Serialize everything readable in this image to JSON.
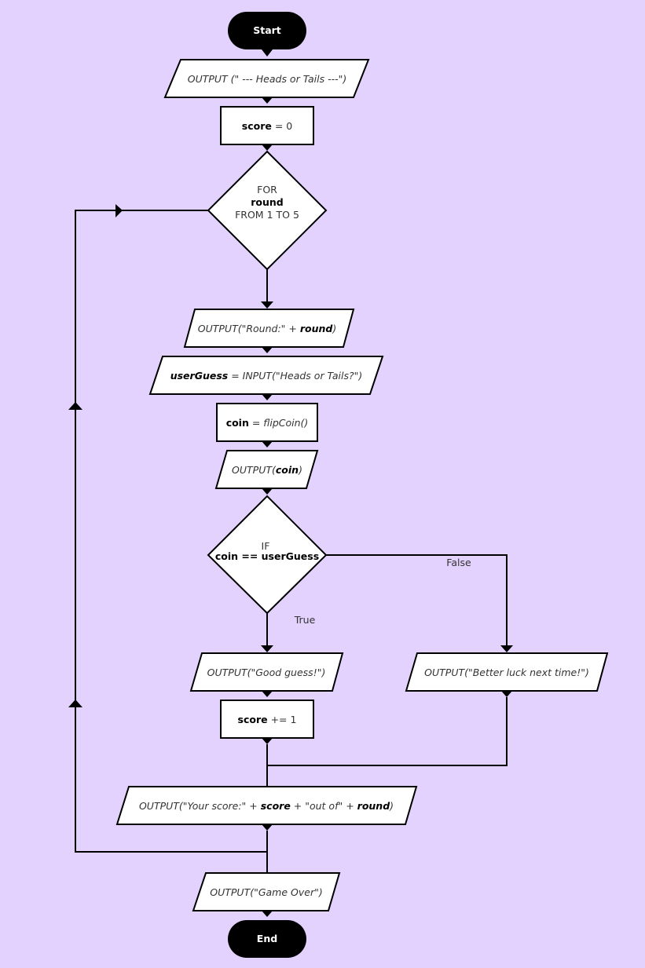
{
  "colors": {
    "background": "#e3d2fe",
    "node_fill": "#ffffff",
    "stroke": "#000000",
    "terminal_fill": "#000000"
  },
  "nodes": {
    "start": "Start",
    "title_output": "OUTPUT (\" --- Heads or Tails ---\")",
    "score_init": {
      "var": "score",
      "rest": " = 0"
    },
    "for_loop": {
      "kw": "FOR",
      "var": "round",
      "range": "FROM 1 TO 5"
    },
    "round_output": {
      "pre": "OUTPUT(\"Round:\" + ",
      "var": "round",
      "post": ")"
    },
    "input_guess": {
      "var": "userGuess",
      "rest": " = INPUT(\"Heads or Tails?\")"
    },
    "flip": {
      "var": "coin",
      "eq": " = ",
      "call": "flipCoin()"
    },
    "coin_output": {
      "pre": "OUTPUT(",
      "var": "coin",
      "post": ")"
    },
    "if_cond": {
      "kw": "IF",
      "cond": "coin == userGuess"
    },
    "good_guess": "OUTPUT(\"Good guess!\")",
    "better_luck": "OUTPUT(\"Better luck next time!\")",
    "score_inc": {
      "var": "score",
      "rest": " += 1"
    },
    "score_output": {
      "p1": "OUTPUT(\"Your score:\" + ",
      "v1": "score",
      "p2": " + \"out of\" + ",
      "v2": "round",
      "p3": ")"
    },
    "game_over": "OUTPUT(\"Game Over\")",
    "end": "End"
  },
  "edges": {
    "true_label": "True",
    "false_label": "False"
  }
}
